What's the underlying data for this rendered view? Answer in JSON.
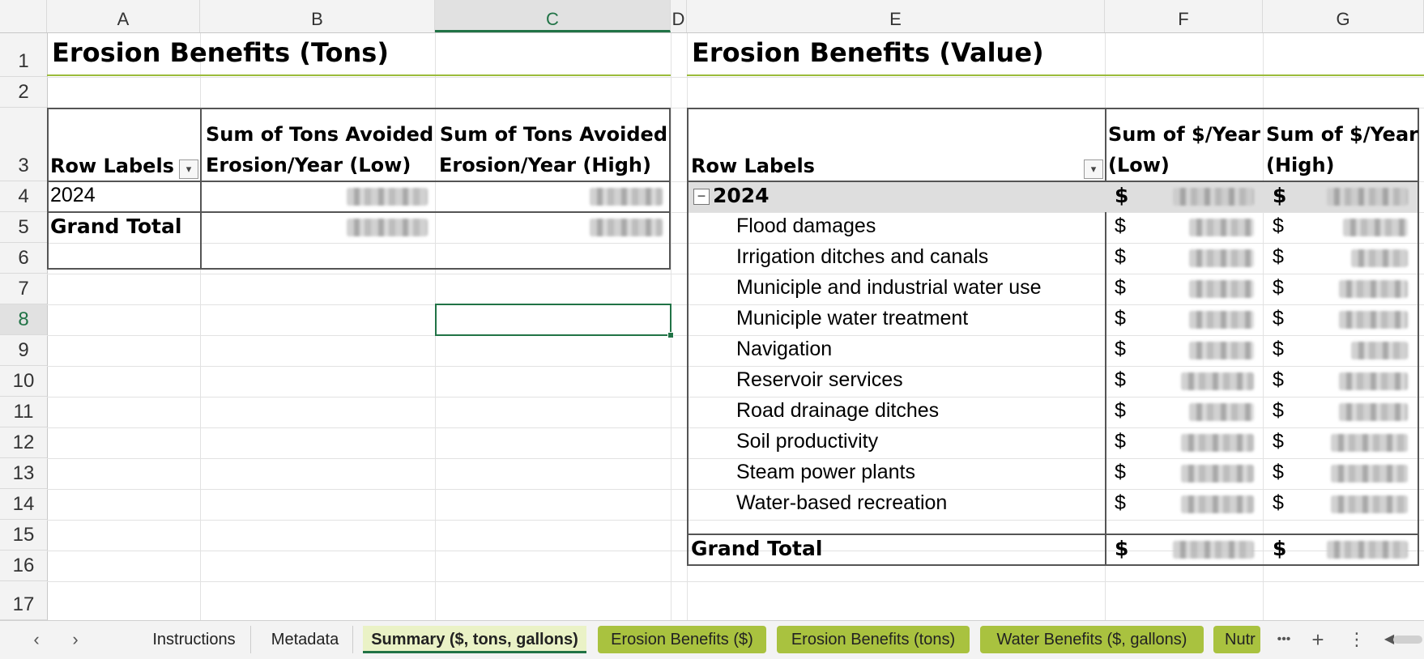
{
  "columns": [
    "A",
    "B",
    "C",
    "D",
    "E",
    "F",
    "G"
  ],
  "selected_column": "C",
  "rows": [
    "1",
    "2",
    "3",
    "4",
    "5",
    "6",
    "7",
    "8",
    "9",
    "10",
    "11",
    "12",
    "13",
    "14",
    "15",
    "16",
    "17"
  ],
  "selected_row": "8",
  "left_pivot": {
    "title": "Erosion Benefits (Tons)",
    "row_labels_header": "Row Labels",
    "col_low_line1": "Sum of Tons Avoided",
    "col_low_line2": "Erosion/Year (Low)",
    "col_high_line1": "Sum of Tons Avoided",
    "col_high_line2": "Erosion/Year (High)",
    "year_label": "2024",
    "grand_total": "Grand Total"
  },
  "right_pivot": {
    "title": "Erosion Benefits (Value)",
    "row_labels_header": "Row Labels",
    "col_low_line1": "Sum of $/Year",
    "col_low_line2": "(Low)",
    "col_high_line1": "Sum of $/Year",
    "col_high_line2": "(High)",
    "year_label": "2024",
    "collapse_symbol": "−",
    "currency": "$",
    "items": [
      "Flood damages",
      "Irrigation ditches and canals",
      "Municiple and industrial water use",
      "Municiple water treatment",
      "Navigation",
      "Reservoir services",
      "Road drainage ditches",
      "Soil productivity",
      "Steam power plants",
      "Water-based recreation"
    ],
    "grand_total": "Grand Total"
  },
  "tabs": [
    "Instructions",
    "Metadata",
    "Summary ($, tons, gallons)",
    "Erosion Benefits ($)",
    "Erosion Benefits (tons)",
    "Water Benefits ($, gallons)",
    "Nutr"
  ],
  "active_tab": "Summary ($, tons, gallons)",
  "tab_colors": {
    "green": "#a9c23f",
    "active_bg": "#eaf2c6",
    "accent": "#217346"
  },
  "nav": {
    "prev": "‹",
    "next": "›",
    "more": "•••",
    "add": "+",
    "options": "⋮",
    "scroll": "◀"
  }
}
